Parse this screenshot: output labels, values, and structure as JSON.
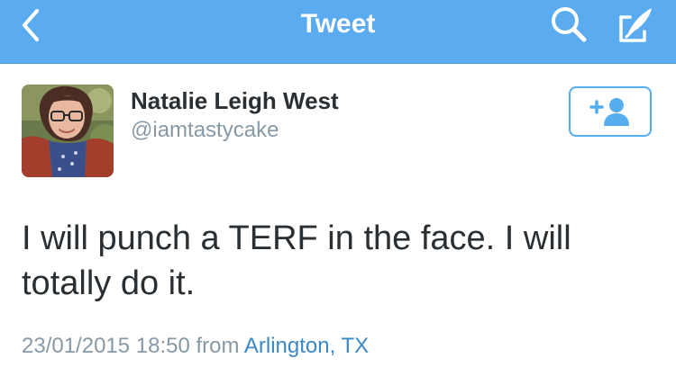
{
  "header": {
    "title": "Tweet",
    "back_icon": "chevron-left-icon",
    "search_icon": "search-icon",
    "compose_icon": "compose-icon",
    "color": "#5aabef"
  },
  "tweet": {
    "author": {
      "display_name": "Natalie Leigh West",
      "handle": "@iamtastycake"
    },
    "follow_icon": "add-user-icon",
    "text": "I will punch a TERF in the face. I will totally do it.",
    "timestamp": "23/01/2015 18:50",
    "from_label": "from",
    "location": "Arlington, TX",
    "link_color": "#3b88c3"
  }
}
